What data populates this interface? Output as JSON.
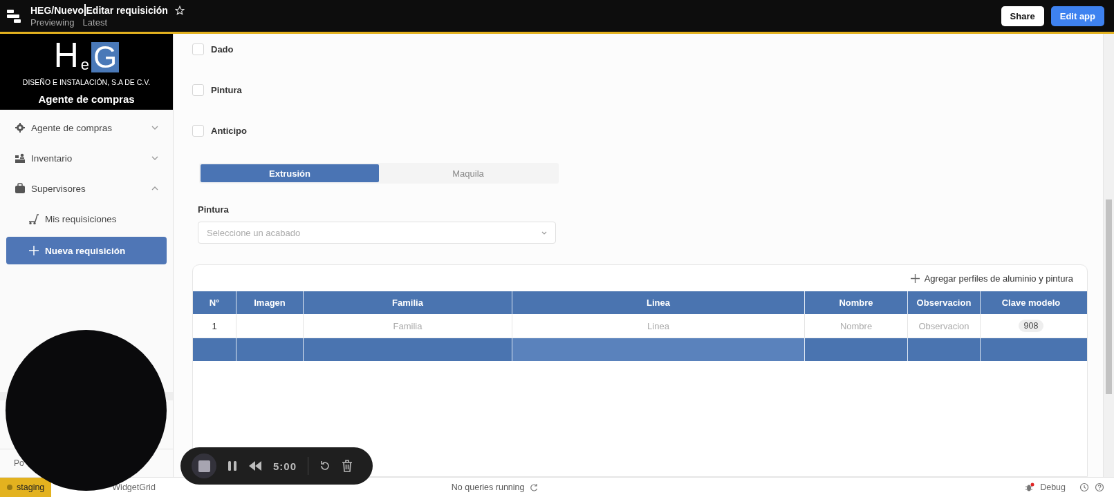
{
  "app_bar": {
    "title_before_cursor": "HEG/Nuevo",
    "title_after_cursor": "Editar requisición",
    "starred": false,
    "subtitle": [
      "Previewing",
      "Latest"
    ],
    "buttons": [
      {
        "label": "Share",
        "kind": "plain"
      },
      {
        "label": "Edit app",
        "kind": "primary"
      }
    ]
  },
  "sidebar": {
    "logo_letters": [
      "H",
      "e",
      "G"
    ],
    "company": "DISEÑO E INSTALACIÓN, S.A DE C.V.",
    "heading": "Agente de compras",
    "items": [
      {
        "label": "Agente de compras",
        "kind": "group",
        "expanded": false,
        "selected": false
      },
      {
        "label": "Inventario",
        "kind": "group",
        "expanded": false,
        "selected": false
      },
      {
        "label": "Supervisores",
        "kind": "group",
        "expanded": true,
        "selected": false
      },
      {
        "label": "Mis requisiciones",
        "kind": "link",
        "selected": false
      },
      {
        "label": "Nueva requisición",
        "kind": "link",
        "selected": true
      }
    ],
    "footer": "Po"
  },
  "form": {
    "checkboxes": [
      {
        "label": "Dado",
        "checked": false
      },
      {
        "label": "Pintura",
        "checked": false
      },
      {
        "label": "Anticipo",
        "checked": false
      }
    ],
    "segments": [
      {
        "label": "Extrusión",
        "selected": true
      },
      {
        "label": "Maquila",
        "selected": false
      }
    ],
    "select": {
      "label": "Pintura",
      "placeholder": "Seleccione un acabado"
    },
    "table": {
      "action": "Agregar perfiles de aluminio y pintura",
      "columns": [
        "N°",
        "Imagen",
        "Familia",
        "Linea",
        "Nombre",
        "Observacion",
        "Clave modelo"
      ],
      "rows": [
        {
          "selected": false,
          "cells": [
            {
              "kind": "text",
              "text": "1"
            },
            {
              "kind": "empty"
            },
            {
              "kind": "placeholder",
              "text": "Familia"
            },
            {
              "kind": "placeholder",
              "text": "Linea"
            },
            {
              "kind": "placeholder",
              "text": "Nombre"
            },
            {
              "kind": "placeholder",
              "text": "Observacion"
            },
            {
              "kind": "tag",
              "text": "908"
            }
          ]
        },
        {
          "selected": true,
          "cells": [
            {
              "kind": "empty"
            },
            {
              "kind": "empty"
            },
            {
              "kind": "empty"
            },
            {
              "kind": "empty",
              "hovered": true
            },
            {
              "kind": "empty"
            },
            {
              "kind": "empty"
            },
            {
              "kind": "empty"
            }
          ]
        }
      ]
    }
  },
  "recorder": {
    "time": "5:00"
  },
  "status_bar": {
    "environment": "staging",
    "widget": "WidgetGrid",
    "queries": "No queries running",
    "debug": "Debug"
  }
}
